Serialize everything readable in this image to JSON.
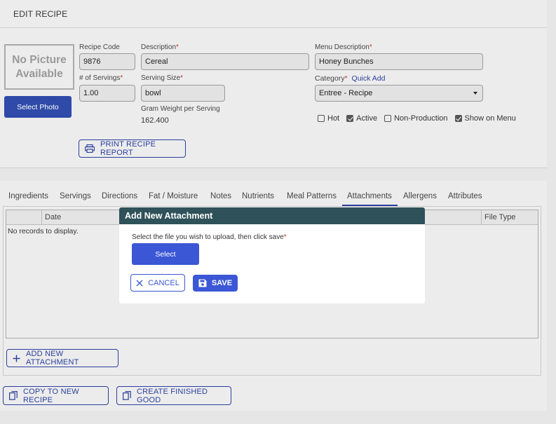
{
  "header": {
    "title": "EDIT RECIPE"
  },
  "photo": {
    "placeholder": "No Picture Available",
    "button": "Select Photo"
  },
  "fields": {
    "recipe_code": {
      "label": "Recipe Code",
      "value": "9876"
    },
    "description": {
      "label": "Description",
      "req": "*",
      "value": "Cereal"
    },
    "menu_description": {
      "label": "Menu Description",
      "req": "*",
      "value": "Honey Bunches"
    },
    "servings": {
      "label": "# of Servings",
      "req": "*",
      "value": "1.00"
    },
    "serving_size": {
      "label": "Serving Size",
      "req": "*",
      "value": "bowl"
    },
    "category": {
      "label": "Category",
      "req": "*",
      "quick_add": "Quick Add",
      "value": "Entree - Recipe"
    },
    "gram_weight": {
      "label": "Gram Weight per Serving",
      "value": "162.400"
    }
  },
  "checkboxes": [
    {
      "label": "Hot",
      "checked": false
    },
    {
      "label": "Active",
      "checked": true
    },
    {
      "label": "Non-Production",
      "checked": false
    },
    {
      "label": "Show on Menu",
      "checked": true
    }
  ],
  "print_button": "PRINT RECIPE REPORT",
  "tabs": [
    "Ingredients",
    "Servings",
    "Directions",
    "Fat / Moisture",
    "Notes",
    "Nutrients",
    "Meal Patterns",
    "Attachments",
    "Allergens",
    "Attributes"
  ],
  "active_tab": "Attachments",
  "grid": {
    "columns": [
      "Date",
      "File Type"
    ],
    "empty": "No records to display."
  },
  "add_attachment_button": "ADD NEW ATTACHMENT",
  "footer": {
    "copy_button": "COPY TO NEW RECIPE",
    "finished_button": "CREATE FINISHED GOOD"
  },
  "modal": {
    "title": "Add New Attachment",
    "prompt": "Select the file you wish to upload, then click save",
    "req": "*",
    "select_button": "Select",
    "cancel_button": "CANCEL",
    "save_button": "SAVE"
  },
  "colors": {
    "primary": "#3b57d6",
    "modal_header": "#2f5159"
  }
}
